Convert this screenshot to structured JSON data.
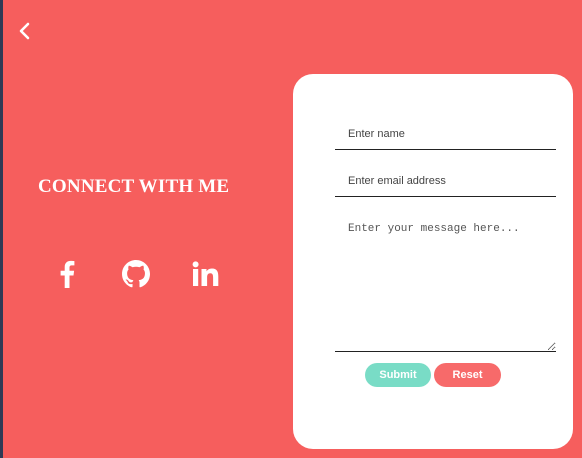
{
  "page": {
    "background_color": "#f65e5d",
    "heading": "CONNECT WITH ME"
  },
  "back_button": {
    "icon": "chevron-left-icon"
  },
  "social_links": [
    {
      "icon": "facebook-icon"
    },
    {
      "icon": "github-icon"
    },
    {
      "icon": "linkedin-icon"
    }
  ],
  "form": {
    "name_placeholder": "Enter name",
    "email_placeholder": "Enter email address",
    "message_placeholder": "Enter your message here...",
    "submit_label": "Submit",
    "reset_label": "Reset",
    "submit_color": "#79dcc6",
    "reset_color": "#f76a6a"
  }
}
